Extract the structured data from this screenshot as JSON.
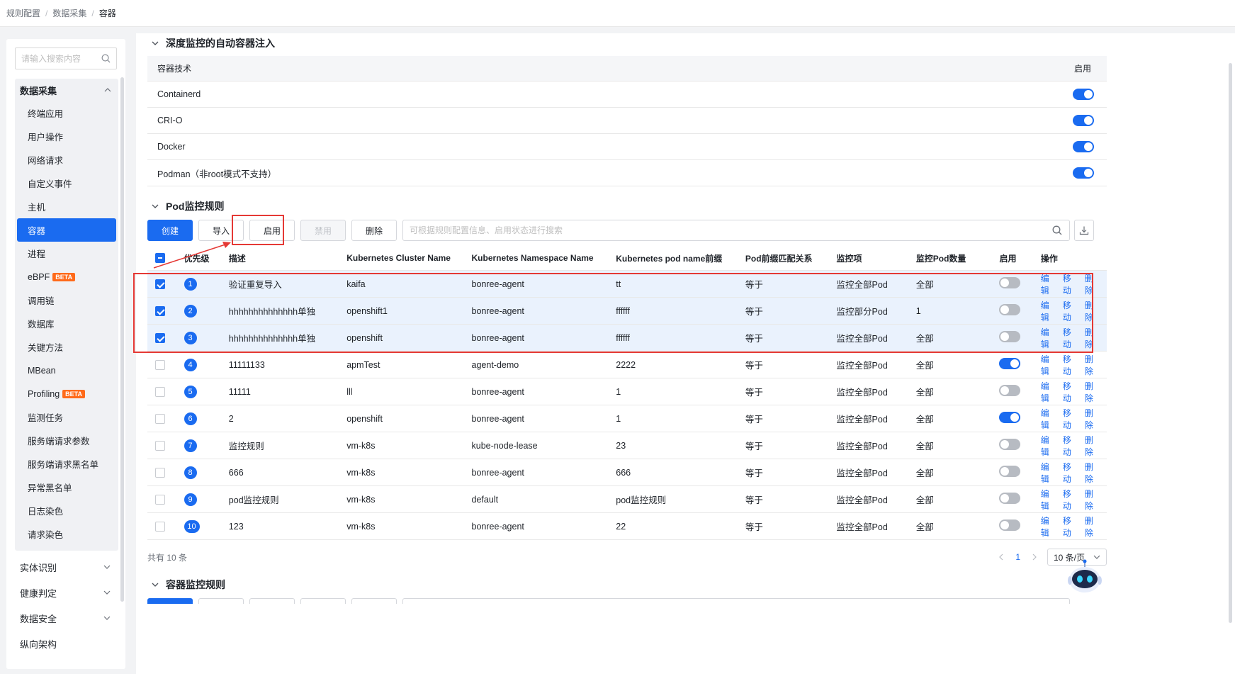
{
  "breadcrumb": [
    "规则配置",
    "数据采集",
    "容器"
  ],
  "sidebar": {
    "search_placeholder": "请输入搜索内容",
    "group_title": "数据采集",
    "items": [
      {
        "label": "终端应用"
      },
      {
        "label": "用户操作"
      },
      {
        "label": "网络请求"
      },
      {
        "label": "自定义事件"
      },
      {
        "label": "主机"
      },
      {
        "label": "容器",
        "active": true
      },
      {
        "label": "进程"
      },
      {
        "label": "eBPF",
        "badge": "BETA"
      },
      {
        "label": "调用链"
      },
      {
        "label": "数据库"
      },
      {
        "label": "关键方法"
      },
      {
        "label": "MBean"
      },
      {
        "label": "Profiling",
        "badge": "BETA"
      },
      {
        "label": "监测任务"
      },
      {
        "label": "服务端请求参数"
      },
      {
        "label": "服务端请求黑名单"
      },
      {
        "label": "异常黑名单"
      },
      {
        "label": "日志染色"
      },
      {
        "label": "请求染色"
      }
    ],
    "collapsed_groups": [
      "实体识别",
      "健康判定",
      "数据安全"
    ],
    "footer_item": "纵向架构"
  },
  "container_section": {
    "title": "深度监控的自动容器注入",
    "header_tech": "容器技术",
    "header_enable": "启用",
    "rows": [
      {
        "name": "Containerd",
        "enabled": true
      },
      {
        "name": "CRI-O",
        "enabled": true
      },
      {
        "name": "Docker",
        "enabled": true
      },
      {
        "name": "Podman（非root模式不支持）",
        "enabled": true
      }
    ]
  },
  "pod_section": {
    "title": "Pod监控规则",
    "buttons": {
      "create": "创建",
      "import": "导入",
      "enable": "启用",
      "disable": "禁用",
      "delete": "删除"
    },
    "search_placeholder": "可根据规则配置信息、启用状态进行搜索",
    "columns": [
      "优先级",
      "描述",
      "Kubernetes Cluster Name",
      "Kubernetes Namespace Name",
      "Kubernetes pod name前缀",
      "Pod前缀匹配关系",
      "监控项",
      "监控Pod数量",
      "启用",
      "操作"
    ],
    "rows": [
      {
        "checked": true,
        "priority": "1",
        "desc": "验证重复导入",
        "cluster": "kaifa",
        "namespace": "bonree-agent",
        "pod_prefix": "tt",
        "match": "等于",
        "monitor": "监控全部Pod",
        "count": "全部",
        "enabled": false
      },
      {
        "checked": true,
        "priority": "2",
        "desc": "hhhhhhhhhhhhhh单独",
        "cluster": "openshift1",
        "namespace": "bonree-agent",
        "pod_prefix": "ffffff",
        "match": "等于",
        "monitor": "监控部分Pod",
        "count": "1",
        "enabled": false
      },
      {
        "checked": true,
        "priority": "3",
        "desc": "hhhhhhhhhhhhhh单独",
        "cluster": "openshift",
        "namespace": "bonree-agent",
        "pod_prefix": "ffffff",
        "match": "等于",
        "monitor": "监控全部Pod",
        "count": "全部",
        "enabled": false
      },
      {
        "checked": false,
        "priority": "4",
        "desc": "11111133",
        "cluster": "apmTest",
        "namespace": "agent-demo",
        "pod_prefix": "2222",
        "match": "等于",
        "monitor": "监控全部Pod",
        "count": "全部",
        "enabled": true
      },
      {
        "checked": false,
        "priority": "5",
        "desc": "11111",
        "cluster": "lll",
        "namespace": "bonree-agent",
        "pod_prefix": "1",
        "match": "等于",
        "monitor": "监控全部Pod",
        "count": "全部",
        "enabled": false
      },
      {
        "checked": false,
        "priority": "6",
        "desc": "2",
        "cluster": "openshift",
        "namespace": "bonree-agent",
        "pod_prefix": "1",
        "match": "等于",
        "monitor": "监控全部Pod",
        "count": "全部",
        "enabled": true
      },
      {
        "checked": false,
        "priority": "7",
        "desc": "监控规则",
        "cluster": "vm-k8s",
        "namespace": "kube-node-lease",
        "pod_prefix": "23",
        "match": "等于",
        "monitor": "监控全部Pod",
        "count": "全部",
        "enabled": false
      },
      {
        "checked": false,
        "priority": "8",
        "desc": "666",
        "cluster": "vm-k8s",
        "namespace": "bonree-agent",
        "pod_prefix": "666",
        "match": "等于",
        "monitor": "监控全部Pod",
        "count": "全部",
        "enabled": false
      },
      {
        "checked": false,
        "priority": "9",
        "desc": "pod监控规则",
        "cluster": "vm-k8s",
        "namespace": "default",
        "pod_prefix": "pod监控规则",
        "match": "等于",
        "monitor": "监控全部Pod",
        "count": "全部",
        "enabled": false
      },
      {
        "checked": false,
        "priority": "10",
        "desc": "123",
        "cluster": "vm-k8s",
        "namespace": "bonree-agent",
        "pod_prefix": "22",
        "match": "等于",
        "monitor": "监控全部Pod",
        "count": "全部",
        "enabled": false
      }
    ],
    "actions": {
      "edit": "编辑",
      "move": "移动",
      "delete": "删除"
    },
    "total": "共有 10 条",
    "page": "1",
    "page_size": "10 条/页"
  },
  "container_rules_section": {
    "title": "容器监控规则"
  },
  "colors": {
    "accent": "#1a6bf0",
    "highlight": "#e53935",
    "beta": "#ff6a1a"
  }
}
